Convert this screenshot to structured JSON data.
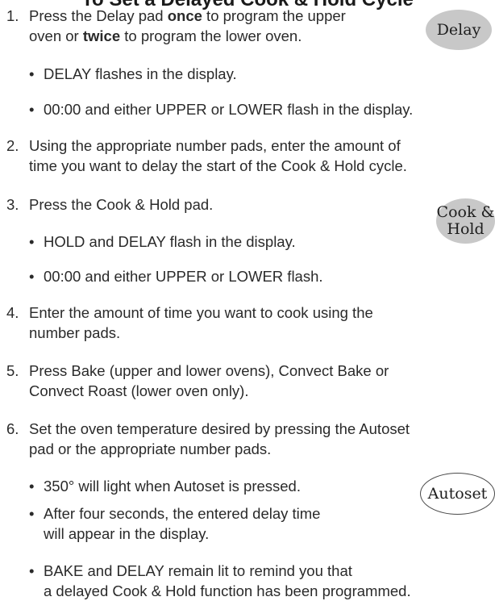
{
  "doc": {
    "title": "To Set a Delayed Cook & Hold Cycle",
    "steps": [
      {
        "num": "1.",
        "lines": [
          "Press the Delay pad ",
          "once",
          " to program the upper",
          "oven or ",
          "twice",
          " to program the lower oven."
        ]
      },
      {
        "num": "2.",
        "lines": [
          "Using the appropriate number pads, enter the amount of",
          "time you want to delay the start of the Cook & Hold cycle."
        ]
      },
      {
        "num": "3.",
        "lines": [
          "Press the Cook & Hold pad."
        ]
      },
      {
        "num": "4.",
        "lines": [
          "Enter the amount of time you want to cook using the",
          "number pads."
        ]
      },
      {
        "num": "5.",
        "lines": [
          "Press Bake (upper and lower ovens), Convect Bake or",
          "Convect Roast (lower oven only)."
        ]
      },
      {
        "num": "6.",
        "lines": [
          "Set the oven temperature desired by pressing the Autoset",
          "pad or the appropriate number pads."
        ]
      }
    ],
    "bullets": {
      "s1": [
        "DELAY flashes in the display.",
        "00:00 and either UPPER or LOWER flash in the display."
      ],
      "s3": [
        "HOLD and DELAY flash in the display.",
        "00:00 and either UPPER or LOWER flash."
      ],
      "s6": [
        [
          "350° will light when Autoset is pressed."
        ],
        [
          "After four seconds, the entered delay time",
          "will appear in the display."
        ],
        [
          "BAKE and DELAY remain lit to remind you that",
          "a delayed Cook & Hold function has been programmed."
        ]
      ]
    },
    "bullet_char": "•",
    "pads": {
      "delay": "Delay",
      "cook_hold_1": "Cook &",
      "cook_hold_2": "Hold",
      "autoset": "Autoset"
    }
  }
}
